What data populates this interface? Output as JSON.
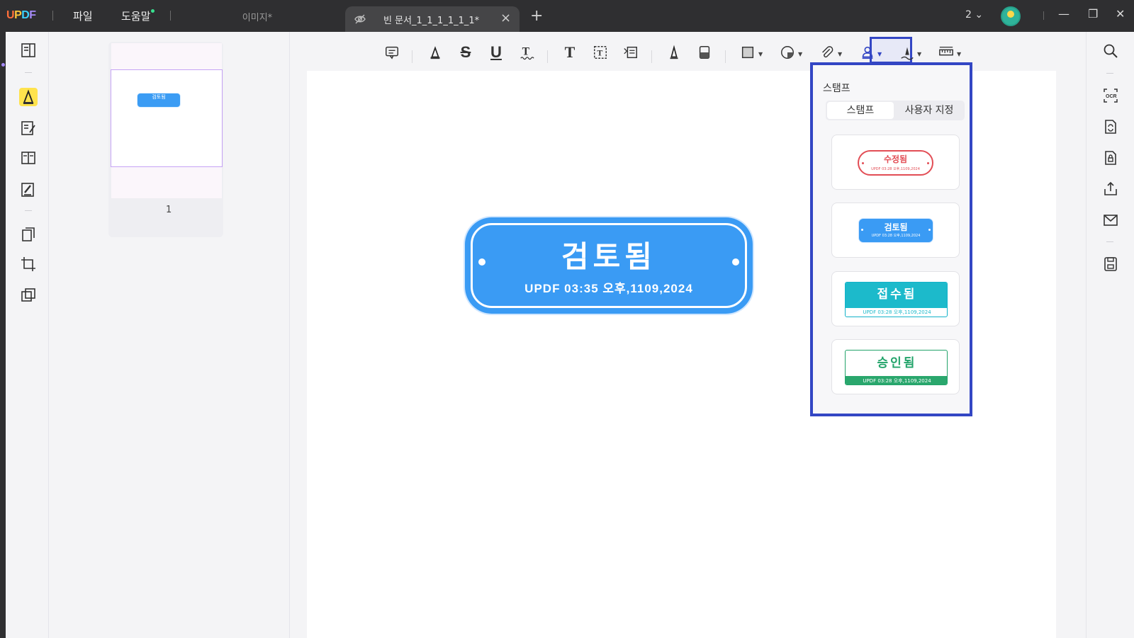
{
  "app": {
    "logo": "UPDF"
  },
  "menu": {
    "file": "파일",
    "help": "도움말"
  },
  "tabs": [
    {
      "label": "이미지*",
      "active": false
    },
    {
      "label": "빈 문서_1_1_1_1_1_1*",
      "active": true
    }
  ],
  "titlebar": {
    "page_count": "2"
  },
  "toolbar": {
    "tools": [
      "comment-icon",
      "highlight-icon",
      "strikethrough-icon",
      "underline-icon",
      "squiggly-icon",
      "text-icon",
      "textbox-icon",
      "text-callout-icon",
      "pencil-icon",
      "eraser-icon",
      "shape-icon",
      "sticker-icon",
      "attachment-icon",
      "stamp-icon",
      "signature-icon",
      "measure-icon"
    ],
    "active_tool": "stamp-icon"
  },
  "thumbnail": {
    "page_number": "1",
    "stamp_text": "검토됨"
  },
  "document_stamp": {
    "title": "검토됨",
    "subtitle": "UPDF 03:35 오후,1109,2024",
    "color": "#3a9bf4"
  },
  "stamp_panel": {
    "title": "스탬프",
    "tabs": [
      "스탬프",
      "사용자 지정"
    ],
    "active_tab": 0,
    "stamps": [
      {
        "label": "수정됨",
        "sub": "UPDF 03:28 오후,1109,2024",
        "color": "#e24d55"
      },
      {
        "label": "검토됨",
        "sub": "UPDF 03:28 오후,1109,2024",
        "color": "#3a9bf4"
      },
      {
        "label": "접수됨",
        "sub": "UPDF 03:28 오후,1109,2024",
        "color": "#1cbacb"
      },
      {
        "label": "승인됨",
        "sub": "UPDF 03:28 오후,1109,2024",
        "color": "#2aa76d"
      }
    ]
  },
  "colors": {
    "accent_border": "#3346c4",
    "highlight_yellow": "#ffe34d"
  }
}
